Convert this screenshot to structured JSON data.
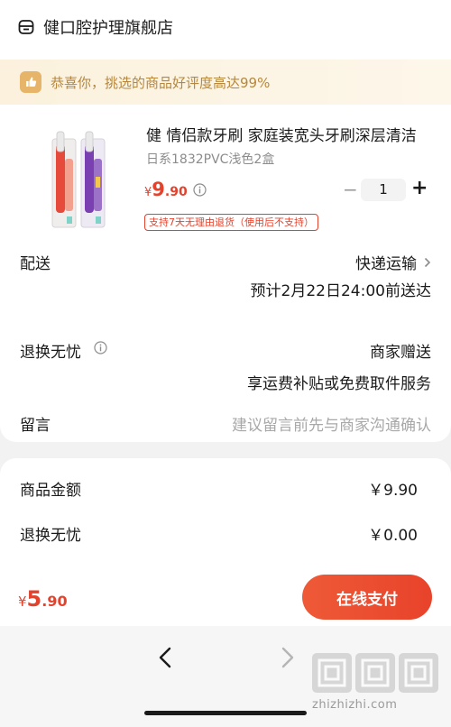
{
  "store": {
    "name": "健口腔护理旗舰店",
    "icon": "store-icon"
  },
  "banner": {
    "icon": "thumbs-up-icon",
    "text": "恭喜你，挑选的商品好评度高达99%"
  },
  "product": {
    "title": "健 情侣款牙刷 家庭装宽头牙刷深层清洁",
    "spec": "日系1832PVC浅色2盒",
    "price_symbol": "¥",
    "price_int": "9",
    "price_dec": ".90",
    "quantity": "1",
    "minus_label": "−",
    "plus_label": "+",
    "return_tag": "支持7天无理由退货（使用后不支持）"
  },
  "delivery": {
    "label": "配送",
    "method": "快递运输",
    "eta": "预计2月22日24:00前送达"
  },
  "returns": {
    "label": "退换无忧",
    "value": "商家赠送",
    "description": "享运费补贴或免费取件服务"
  },
  "message": {
    "label": "留言",
    "placeholder": "建议留言前先与商家沟通确认"
  },
  "summary": {
    "items": [
      {
        "label": "商品金额",
        "value": "￥9.90"
      },
      {
        "label": "退换无忧",
        "value": "￥0.00"
      }
    ]
  },
  "footer": {
    "total_symbol": "¥",
    "total_int": "5",
    "total_dec": ".90",
    "pay_label": "在线支付"
  },
  "watermark": {
    "text": "zhizhizhi.com"
  },
  "colors": {
    "accent": "#e3422d",
    "banner_text": "#b7873b",
    "banner_bg": "#fbf1dd"
  }
}
